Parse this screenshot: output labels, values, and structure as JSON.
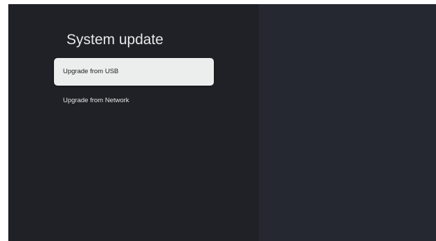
{
  "page": {
    "title": "System update"
  },
  "menu": {
    "items": [
      {
        "label": "Upgrade from USB",
        "selected": true
      },
      {
        "label": "Upgrade from Network",
        "selected": false
      }
    ]
  },
  "colors": {
    "left_pane_bg": "#1f2126",
    "right_pane_bg": "#252830",
    "selected_item_bg": "#eceded",
    "text_light": "#e8e8ea",
    "text_dark": "#202124"
  }
}
